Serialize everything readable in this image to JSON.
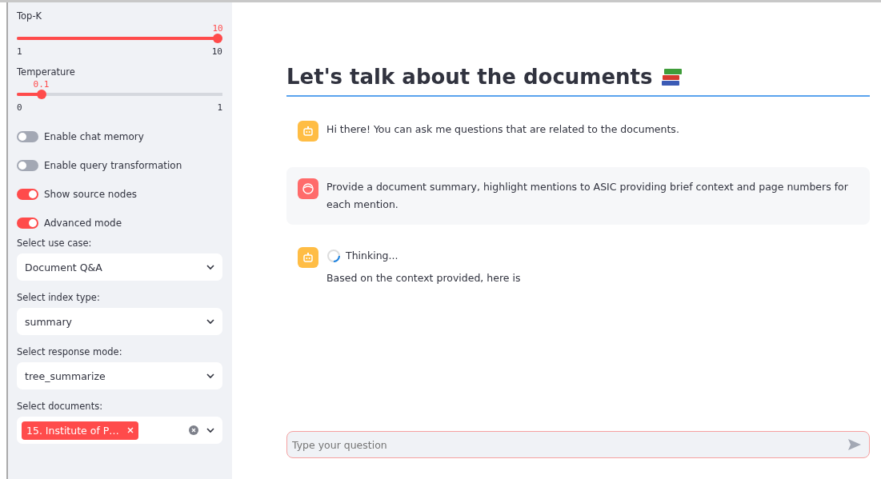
{
  "sidebar": {
    "sliders": [
      {
        "label": "Top-K",
        "value": "10",
        "min": "1",
        "max": "10",
        "level": 1.0
      },
      {
        "label": "Temperature",
        "value": "0.1",
        "min": "0",
        "max": "1",
        "level": 0.1
      }
    ],
    "toggles": [
      {
        "label": "Enable chat memory",
        "on": false
      },
      {
        "label": "Enable query transformation",
        "on": false
      },
      {
        "label": "Show source nodes",
        "on": true
      },
      {
        "label": "Advanced mode",
        "on": true
      }
    ],
    "selects": [
      {
        "label": "Select use case:",
        "value": "Document Q&A"
      },
      {
        "label": "Select index type:",
        "value": "summary"
      },
      {
        "label": "Select response mode:",
        "value": "tree_summarize"
      }
    ],
    "multiselect": {
      "label": "Select documents:",
      "tags": [
        "15. Institute of P…"
      ]
    }
  },
  "main": {
    "title": "Let's talk about the documents",
    "messages": [
      {
        "kind": "assistant",
        "text": "Hi there! You can ask me questions that are related to the documents."
      },
      {
        "kind": "user",
        "text": "Provide a document summary, highlight mentions to ASIC providing brief context and page numbers for each mention."
      },
      {
        "kind": "assistant",
        "status": "Thinking...",
        "text": "Based on the context provided, here is"
      }
    ],
    "input": {
      "placeholder": "Type your question"
    }
  }
}
